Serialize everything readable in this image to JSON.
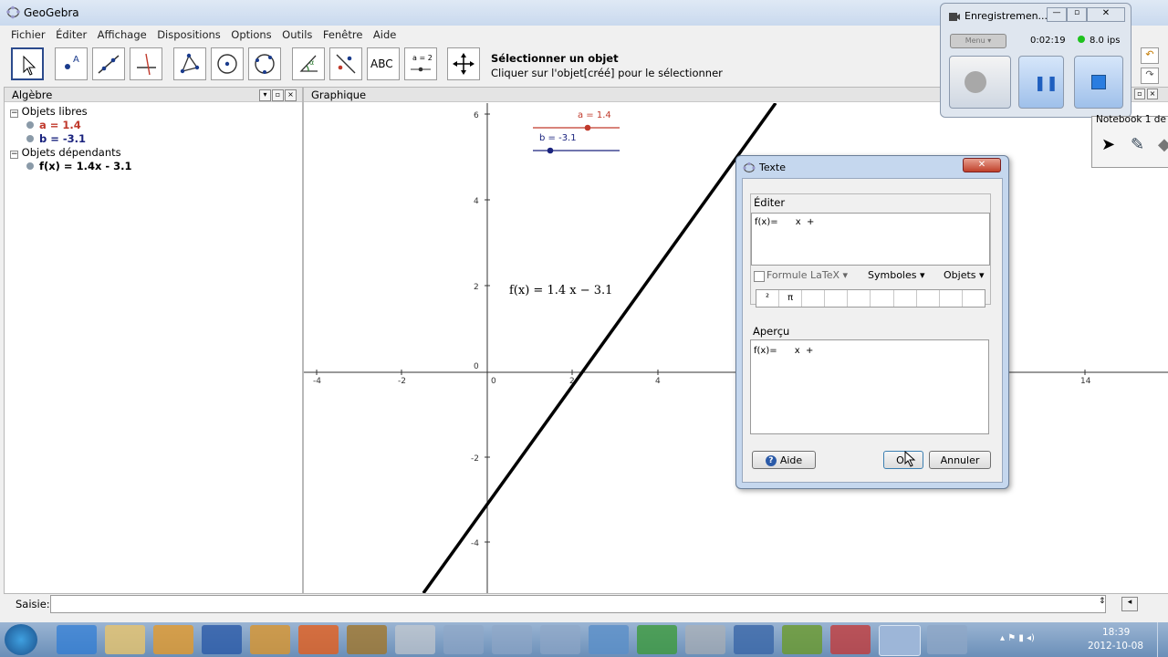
{
  "window": {
    "title": "GeoGebra"
  },
  "menu": [
    "Fichier",
    "Éditer",
    "Affichage",
    "Dispositions",
    "Options",
    "Outils",
    "Fenêtre",
    "Aide"
  ],
  "toolbar": {
    "tool_title": "Sélectionner un objet",
    "tool_help": "Cliquer sur l'objet[créé] pour le sélectionner",
    "abc_label": "ABC",
    "slider_label": "a = 2"
  },
  "algebra": {
    "title": "Algèbre",
    "free_header": "Objets libres",
    "free": [
      "a = 1.4",
      "b = -3.1"
    ],
    "dependent_header": "Objets dépendants",
    "dependent": [
      "f(x) = 1.4x - 3.1"
    ]
  },
  "graphics": {
    "title": "Graphique",
    "x_ticks": [
      "-4",
      "-2",
      "0",
      "2",
      "4",
      "14"
    ],
    "y_ticks": [
      "6",
      "4",
      "2",
      "0",
      "-2",
      "-4"
    ],
    "slider_a": "a = 1.4",
    "slider_b": "b = -3.1",
    "function_text": "f(x) = 1.4 x − 3.1"
  },
  "input": {
    "label": "Saisie:",
    "value": ""
  },
  "dialog": {
    "title": "Texte",
    "edit_label": "Éditer",
    "edit_content": "f(x)=      x  +",
    "latex_label": "Formule LaTeX",
    "symbols_label": "Symboles",
    "objects_label": "Objets",
    "symbol_cells": [
      "²",
      "π",
      "",
      "",
      "",
      "",
      "",
      "",
      "",
      ""
    ],
    "preview_label": "Aperçu",
    "preview_content": "f(x)=      x  +",
    "help_button": "Aide",
    "ok_button": "OK",
    "cancel_button": "Annuler"
  },
  "recorder": {
    "title": "Enregistremen...",
    "menu_label": "Menu",
    "time": "0:02:19",
    "fps": "8.0 ips"
  },
  "notebook": {
    "title": "Notebook  1 de"
  },
  "taskbar": {
    "time": "18:39",
    "date": "2012-10-08"
  },
  "colors": {
    "slider_a": "#c0392b",
    "slider_b": "#1a237e",
    "accent": "#2b4a8c",
    "function_line": "#000000"
  }
}
